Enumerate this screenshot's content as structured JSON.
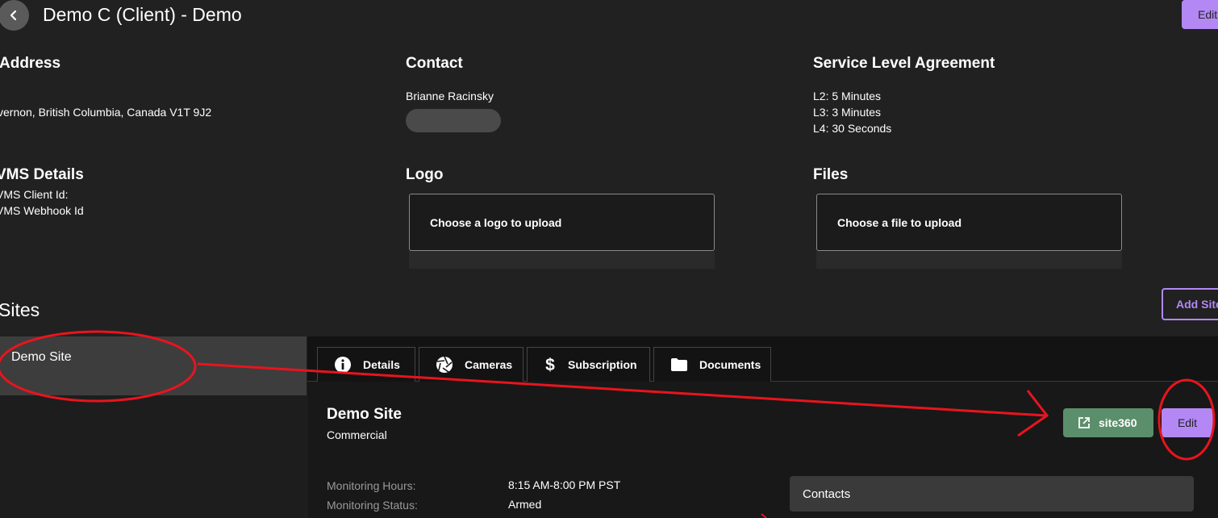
{
  "header": {
    "title": "Demo C (Client) - Demo",
    "edit_label": "Edit"
  },
  "address": {
    "heading": "Address",
    "line": "vernon, British Columbia, Canada V1T 9J2"
  },
  "contact": {
    "heading": "Contact",
    "name": "Brianne Racinsky"
  },
  "sla": {
    "heading": "Service Level Agreement",
    "lines": [
      "L2: 5 Minutes",
      "L3: 3 Minutes",
      "L4: 30 Seconds"
    ]
  },
  "vms": {
    "heading": "VMS Details",
    "client_id_label": "VMS Client Id:",
    "webhook_label": "VMS Webhook Id"
  },
  "logo": {
    "heading": "Logo",
    "upload_label": "Choose a logo to upload"
  },
  "files": {
    "heading": "Files",
    "upload_label": "Choose a file to upload"
  },
  "sites": {
    "heading": "Sites",
    "add_label": "Add Site",
    "items": [
      {
        "label": "Demo Site"
      }
    ]
  },
  "tabs": [
    {
      "label": "Details",
      "icon": "info-icon"
    },
    {
      "label": "Cameras",
      "icon": "camera-shutter-icon"
    },
    {
      "label": "Subscription",
      "icon": "dollar-icon"
    },
    {
      "label": "Documents",
      "icon": "folder-icon"
    }
  ],
  "site_detail": {
    "name": "Demo Site",
    "type": "Commercial",
    "site360_label": "site360",
    "edit_label": "Edit",
    "monitoring_hours_label": "Monitoring Hours:",
    "monitoring_hours_value": "8:15 AM-8:00 PM PST",
    "monitoring_status_label": "Monitoring Status:",
    "monitoring_status_value": "Armed",
    "contacts_label": "Contacts"
  },
  "colors": {
    "accent": "#b388f5",
    "site360": "#5b8f6b",
    "annotation": "#e8141e"
  }
}
